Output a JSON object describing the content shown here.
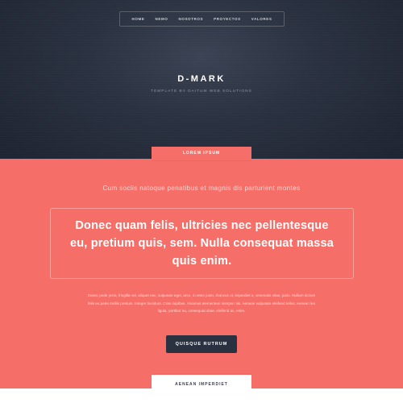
{
  "nav": {
    "items": [
      "Home",
      "Nemo",
      "Nosotros",
      "Proyectos",
      "Valores"
    ]
  },
  "hero": {
    "title": "D-MARK",
    "tagline": "Template by Daitum Web Solutions"
  },
  "section": {
    "tab_label": "Lorem Ipsum",
    "subtitle": "Cum sociis natoque penatibus et magnis dis parturient montes",
    "quote": "Donec quam felis, ultricies nec pellentesque eu, pretium quis, sem. Nulla consequat massa quis enim.",
    "body": "Donec pede justo, fringilla vel, aliquet nec, vulputate eget, arcu. In enim justo, rhoncus ut, imperdiet a, venenatis vitae, justo. Nullam dictum felis eu pede mollis pretium. Integer tincidunt. Cras dapibus. Vivamus elementum semper nisi. Aenean vulputate eleifend tellus. Aenean leo ligula, porttitor eu, consequat vitae, eleifend ac, enim.",
    "cta_label": "Quisque Rutrum",
    "next_tab_label": "Aenean Imperdiet"
  },
  "colors": {
    "hero_bg": "#2a3140",
    "accent": "#f66e68",
    "button_bg": "#2a3140",
    "white": "#ffffff"
  }
}
